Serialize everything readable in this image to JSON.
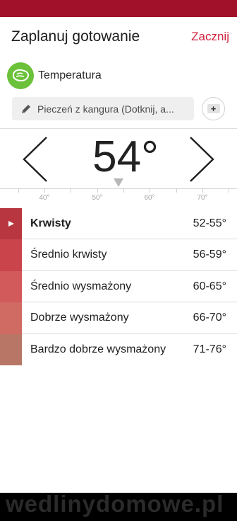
{
  "header": {
    "title": "Zaplanuj gotowanie",
    "start_label": "Zacznij"
  },
  "temperature": {
    "label": "Temperatura",
    "recipe_field": "Pieczeń z kangura (Dotknij, a...",
    "current_value": "54°"
  },
  "scale": {
    "ticks": [
      "40°",
      "50°",
      "60°",
      "70°"
    ]
  },
  "doneness": [
    {
      "name": "Krwisty",
      "range": "52-55°",
      "color": "#b8363f",
      "active": true
    },
    {
      "name": "Średnio krwisty",
      "range": "56-59°",
      "color": "#c9444b"
    },
    {
      "name": "Średnio wysmażony",
      "range": "60-65°",
      "color": "#d35a5b"
    },
    {
      "name": "Dobrze wysmażony",
      "range": "66-70°",
      "color": "#cf6b63"
    },
    {
      "name": "Bardzo dobrze wysmażony",
      "range": "71-76°",
      "color": "#b87766"
    }
  ],
  "watermark": "wedlinydomowe.pl",
  "colors": {
    "status_bar": "#a1122a",
    "accent": "#d0223e",
    "temp_icon_bg": "#6bc13a"
  },
  "icons": {
    "temperature": "steak-icon",
    "recipe": "pencil-icon",
    "add": "add-plate-icon",
    "decrease": "chevron-left-icon",
    "increase": "chevron-right-icon"
  }
}
